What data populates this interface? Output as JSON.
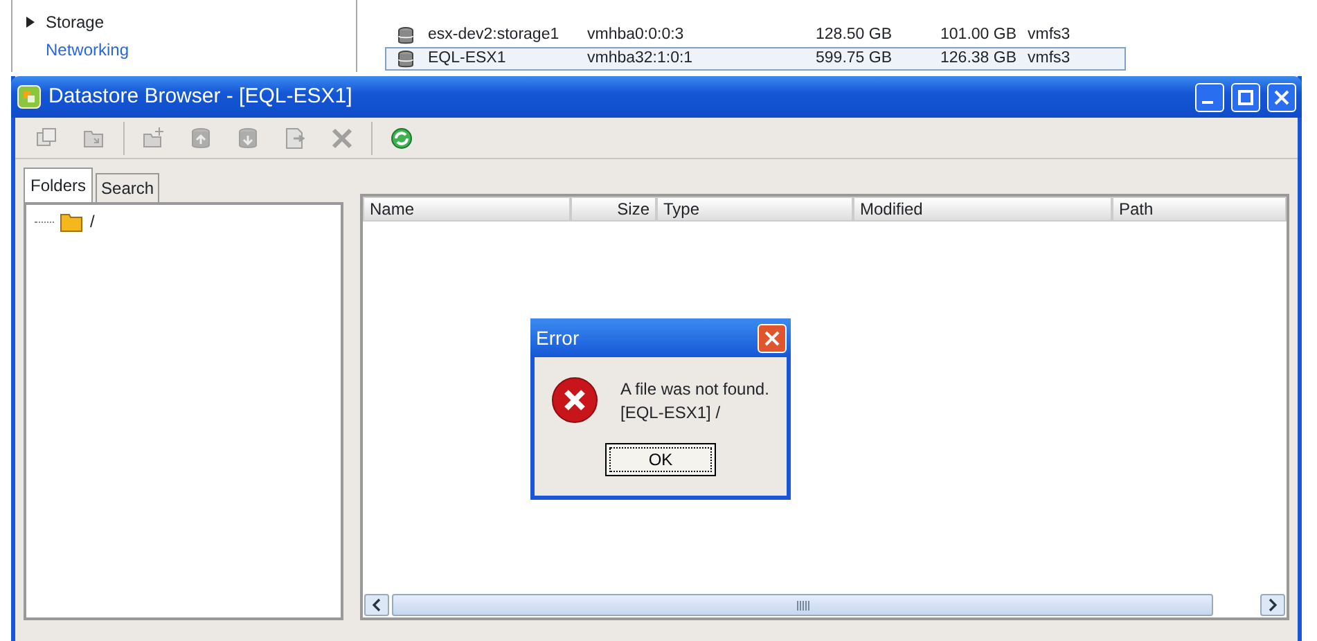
{
  "background_app": {
    "tree": [
      {
        "label": "Storage",
        "kind": "expandable"
      },
      {
        "label": "Networking",
        "kind": "link"
      }
    ],
    "datastores": [
      {
        "name": "esx-dev2:storage1",
        "device": "vmhba0:0:0:3",
        "capacity": "128.50 GB",
        "free": "101.00 GB",
        "type": "vmfs3",
        "selected": false
      },
      {
        "name": "EQL-ESX1",
        "device": "vmhba32:1:0:1",
        "capacity": "599.75 GB",
        "free": "126.38 GB",
        "type": "vmfs3",
        "selected": true
      }
    ]
  },
  "window": {
    "title": "Datastore Browser - [EQL-ESX1]",
    "toolbar": [
      {
        "kind": "copy",
        "disabled": true
      },
      {
        "kind": "paste",
        "disabled": true
      },
      {
        "kind": "new-folder",
        "disabled": true
      },
      {
        "kind": "upload",
        "disabled": true
      },
      {
        "kind": "download",
        "disabled": true
      },
      {
        "kind": "move",
        "disabled": true
      },
      {
        "kind": "delete",
        "disabled": true
      },
      {
        "kind": "refresh",
        "disabled": false
      }
    ],
    "tabs": [
      {
        "label": "Folders",
        "selected": true
      },
      {
        "label": "Search",
        "selected": false
      }
    ],
    "folder_tree": [
      {
        "label": "/"
      }
    ],
    "file_table": {
      "columns": [
        "Name",
        "Size",
        "Type",
        "Modified",
        "Path"
      ]
    }
  },
  "dialog": {
    "title": "Error",
    "message": [
      "A file was not found.",
      "[EQL-ESX1] /"
    ],
    "button": "OK"
  }
}
